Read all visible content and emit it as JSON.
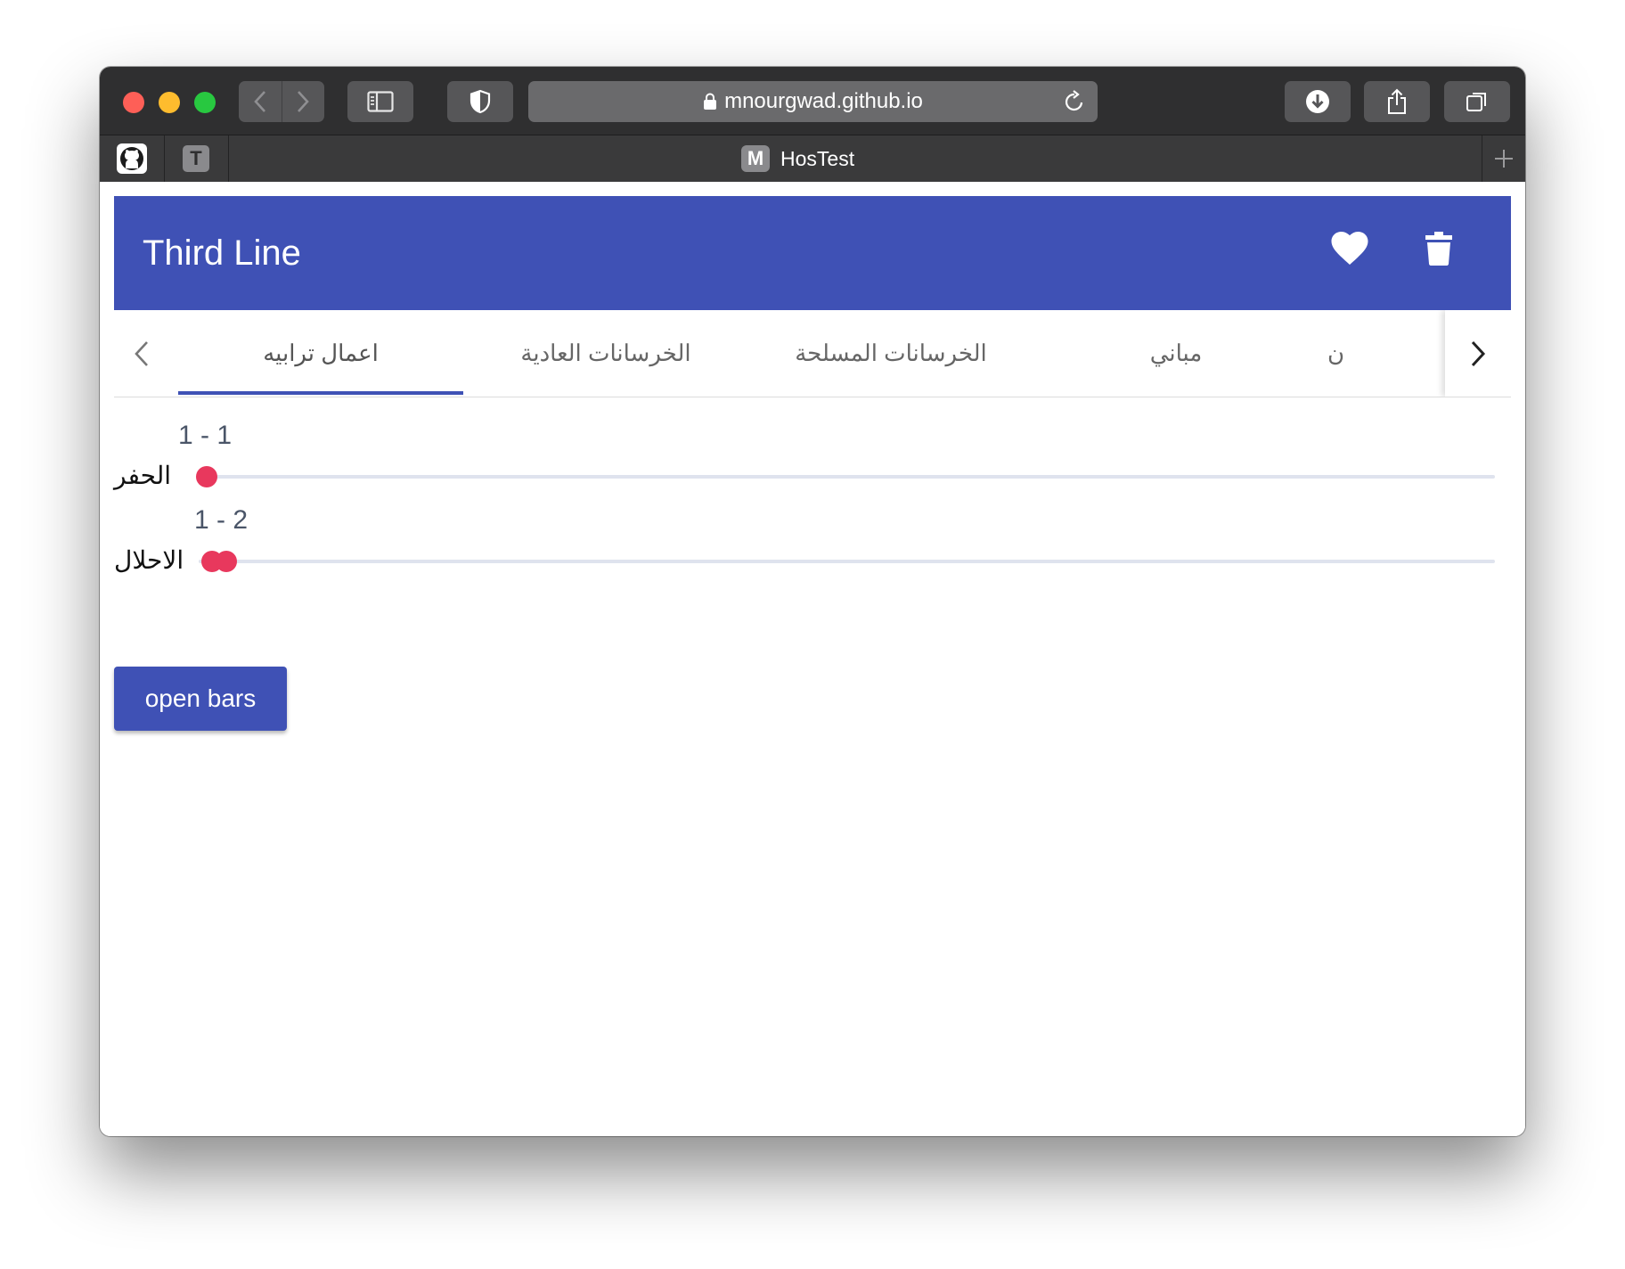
{
  "browser": {
    "url": "mnourgwad.github.io",
    "pinned_tab_2_letter": "T",
    "active_tab": {
      "favicon_letter": "M",
      "title": "HosTest"
    }
  },
  "app": {
    "title": "Third Line",
    "colors": {
      "primary": "#3f51b5",
      "accent": "#e8385d"
    }
  },
  "tabs": [
    {
      "label": "اعمال ترابيه",
      "active": true
    },
    {
      "label": "الخرسانات العادية",
      "active": false
    },
    {
      "label": "الخرسانات المسلحة",
      "active": false
    },
    {
      "label": "مباني",
      "active": false
    },
    {
      "label": "ن",
      "active": false
    }
  ],
  "sliders": [
    {
      "name": "الحفر",
      "range_label": "1 - 1",
      "min": 1,
      "max": 1
    },
    {
      "name": "الاحلال",
      "range_label": "1 - 2",
      "min": 1,
      "max": 2
    }
  ],
  "open_button": {
    "label": "open bars"
  }
}
